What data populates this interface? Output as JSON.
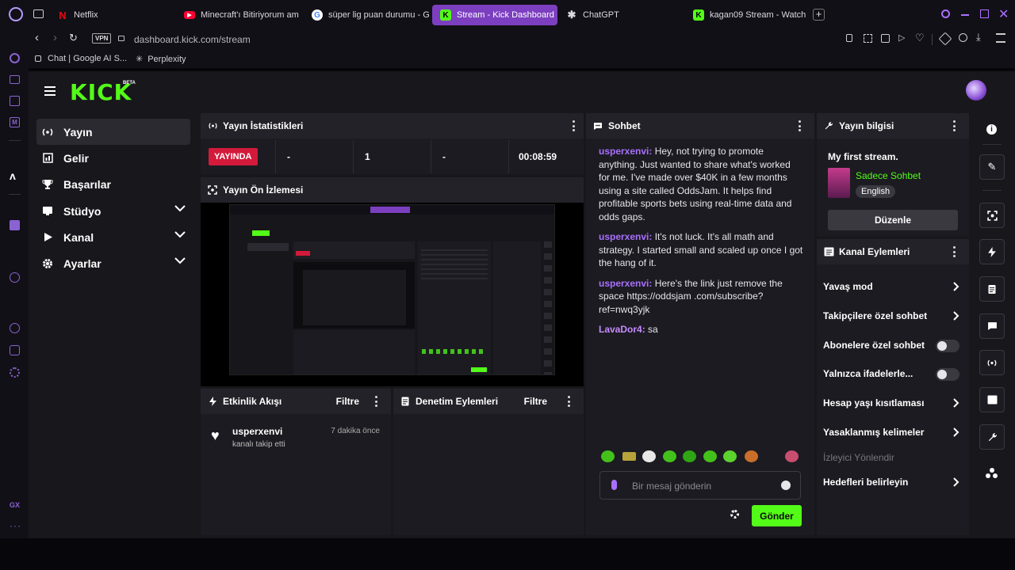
{
  "browser": {
    "tabs": [
      {
        "title": "Netflix",
        "fav": "N",
        "fav_color": "#e50914",
        "active": false
      },
      {
        "title": "Minecraft'ı Bitiriyorum am",
        "fav": "▶",
        "fav_color": "#ff0033",
        "active": false
      },
      {
        "title": "süper lig puan durumu - G",
        "fav": "G",
        "fav_color": "#4285f4",
        "active": false
      },
      {
        "title": "Stream - Kick Dashboard",
        "fav": "K",
        "fav_color": "#53fc18",
        "active": true
      },
      {
        "title": "ChatGPT",
        "fav": "✱",
        "fav_color": "#d9d9df",
        "active": false
      },
      {
        "title": "kagan09 Stream - Watch l",
        "fav": "K",
        "fav_color": "#53fc18",
        "active": false
      }
    ],
    "url": "dashboard.kick.com/stream",
    "vpn": "VPN",
    "bookmarks": [
      "Chat | Google AI S...",
      "Perplexity"
    ],
    "gx_label": "GX"
  },
  "kick": {
    "logo": "KICK",
    "beta": "BETA",
    "accent": "#53fc18",
    "nav": [
      {
        "label": "Yayın",
        "icon": "broadcast-icon",
        "active": true,
        "expand": false
      },
      {
        "label": "Gelir",
        "icon": "chart-icon",
        "active": false,
        "expand": false
      },
      {
        "label": "Başarılar",
        "icon": "trophy-icon",
        "active": false,
        "expand": false
      },
      {
        "label": "Stüdyo",
        "icon": "studio-icon",
        "active": false,
        "expand": true
      },
      {
        "label": "Kanal",
        "icon": "channel-icon",
        "active": false,
        "expand": true
      },
      {
        "label": "Ayarlar",
        "icon": "gear-icon",
        "active": false,
        "expand": true
      }
    ],
    "stats": {
      "title": "Yayın İstatistikleri",
      "live": "YAYINDA",
      "values": [
        "-",
        "1",
        "-",
        "00:08:59"
      ]
    },
    "preview_title": "Yayın Ön İzlemesi",
    "activity": {
      "title": "Etkinlik Akışı",
      "filter": "Filtre",
      "items": [
        {
          "user": "usperxenvi",
          "action": "kanalı takip etti",
          "time": "7 dakika önce"
        }
      ]
    },
    "moderation": {
      "title": "Denetim Eylemleri",
      "filter": "Filtre"
    },
    "chat": {
      "title": "Sohbet",
      "messages": [
        {
          "user": "usperxenvi",
          "text": "Hey, not trying to promote anything. Just wanted to share what's worked for me. I've made over $40K in a few months using a site called OddsJam. It helps find profitable sports bets using real-time data and odds gaps."
        },
        {
          "user": "usperxenvi",
          "text": "It's not luck. It's all math and strategy. I started small and scaled up once I got the hang of it."
        },
        {
          "user": "usperxenvi",
          "text": "Here's the link just remove the space https://oddsjam .com/subscribe?ref=nwq3yjk"
        },
        {
          "user": "LavaDor4",
          "text": "sa"
        }
      ],
      "placeholder": "Bir mesaj gönderin",
      "send": "Gönder"
    },
    "stream_info": {
      "title": "Yayın bilgisi",
      "stream_title": "My first stream.",
      "category": "Sadece Sohbet",
      "language": "English",
      "edit": "Düzenle"
    },
    "channel_actions": {
      "title": "Kanal Eylemleri",
      "items": [
        {
          "label": "Yavaş mod",
          "kind": "chevron"
        },
        {
          "label": "Takipçilere özel sohbet",
          "kind": "chevron"
        },
        {
          "label": "Abonelere özel sohbet",
          "kind": "toggle"
        },
        {
          "label": "Yalnızca ifadelerle...",
          "kind": "toggle"
        },
        {
          "label": "Hesap yaşı kısıtlaması",
          "kind": "chevron"
        },
        {
          "label": "Yasaklanmış kelimeler",
          "kind": "chevron"
        }
      ],
      "disabled_item": "İzleyici Yönlendir",
      "last_item": "Hedefleri belirleyin"
    }
  }
}
